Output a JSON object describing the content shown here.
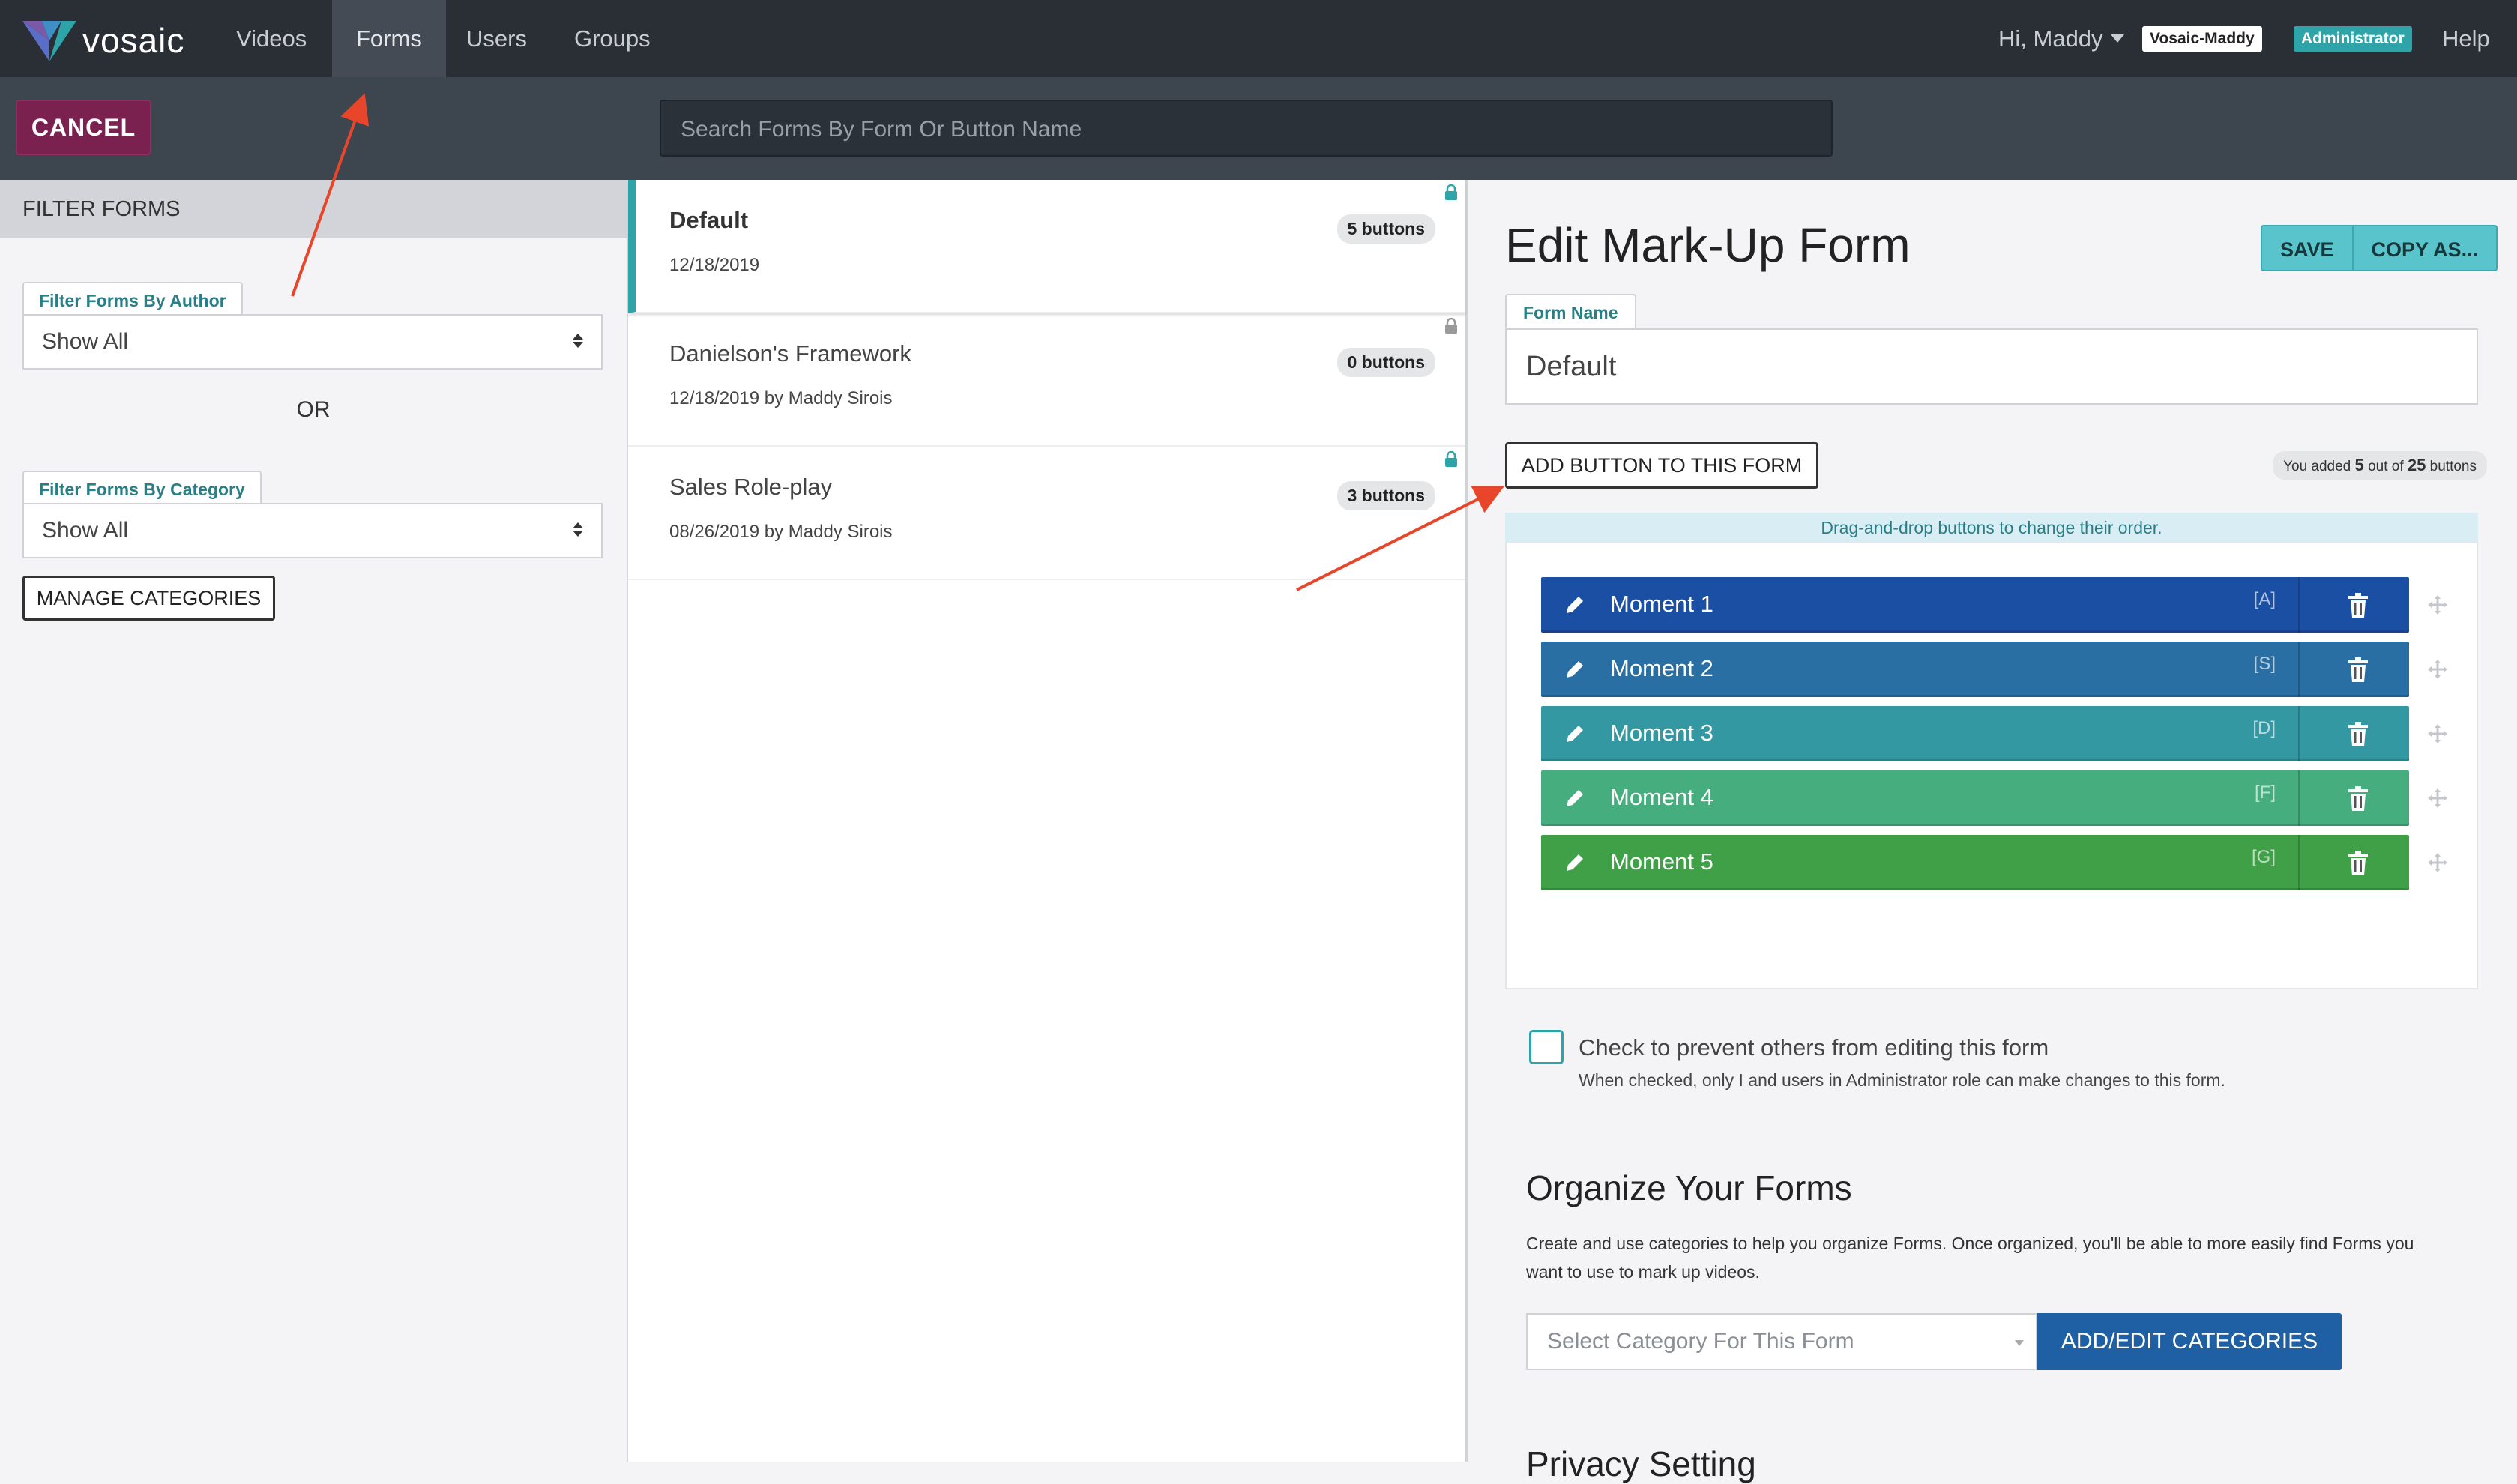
{
  "topnav": {
    "logo": "vosaic",
    "items": [
      "Videos",
      "Forms",
      "Users",
      "Groups"
    ],
    "active": "Forms",
    "greeting": "Hi, Maddy",
    "user_badge": "Vosaic-Maddy",
    "role_badge": "Administrator",
    "help": "Help"
  },
  "subbar": {
    "cancel_label": "CANCEL",
    "search_placeholder": "Search Forms By Form Or Button Name"
  },
  "filters": {
    "heading": "FILTER FORMS",
    "author_label": "Filter Forms By Author",
    "author_value": "Show All",
    "or_label": "OR",
    "category_label": "Filter Forms By Category",
    "category_value": "Show All",
    "manage_label": "MANAGE CATEGORIES"
  },
  "forms": [
    {
      "title": "Default",
      "date": "12/18/2019",
      "count": "5 buttons",
      "lock_color": "#2ea3a8"
    },
    {
      "title": "Danielson's Framework",
      "date": "12/18/2019 by Maddy Sirois",
      "count": "0 buttons",
      "lock_color": "#999999"
    },
    {
      "title": "Sales Role-play",
      "date": "08/26/2019 by Maddy Sirois",
      "count": "3 buttons",
      "lock_color": "#2ea3a8"
    }
  ],
  "editor": {
    "title": "Edit Mark-Up Form",
    "save_label": "SAVE",
    "copy_label": "COPY AS...",
    "name_label": "Form Name",
    "name_value": "Default",
    "add_button_label": "ADD BUTTON TO THIS FORM",
    "added_prefix": "You added",
    "added_count": "5",
    "added_mid": "out of",
    "added_max": "25",
    "added_suffix": "buttons",
    "dnd_hint": "Drag-and-drop buttons to change their order.",
    "moments": [
      {
        "label": "Moment 1",
        "key": "[A]",
        "color": "#1b4fa3"
      },
      {
        "label": "Moment 2",
        "key": "[S]",
        "color": "#2a6fa3"
      },
      {
        "label": "Moment 3",
        "key": "[D]",
        "color": "#3498a3"
      },
      {
        "label": "Moment 4",
        "key": "[F]",
        "color": "#46ad7e"
      },
      {
        "label": "Moment 5",
        "key": "[G]",
        "color": "#3fa048"
      }
    ],
    "lock_check_label": "Check to prevent others from editing this form",
    "lock_check_sub": "When checked, only I and users in Administrator role can make changes to this form.",
    "organize_title": "Organize Your Forms",
    "organize_text": "Create and use categories to help you organize Forms. Once organized, you'll be able to more easily find Forms you want to use to mark up videos.",
    "category_placeholder": "Select Category For This Form",
    "category_button": "ADD/EDIT CATEGORIES",
    "privacy_title": "Privacy Setting"
  },
  "colors": {
    "accent": "#2ea3a8",
    "cancel": "#7b2150",
    "annotation_arrow": "#e8462a"
  }
}
